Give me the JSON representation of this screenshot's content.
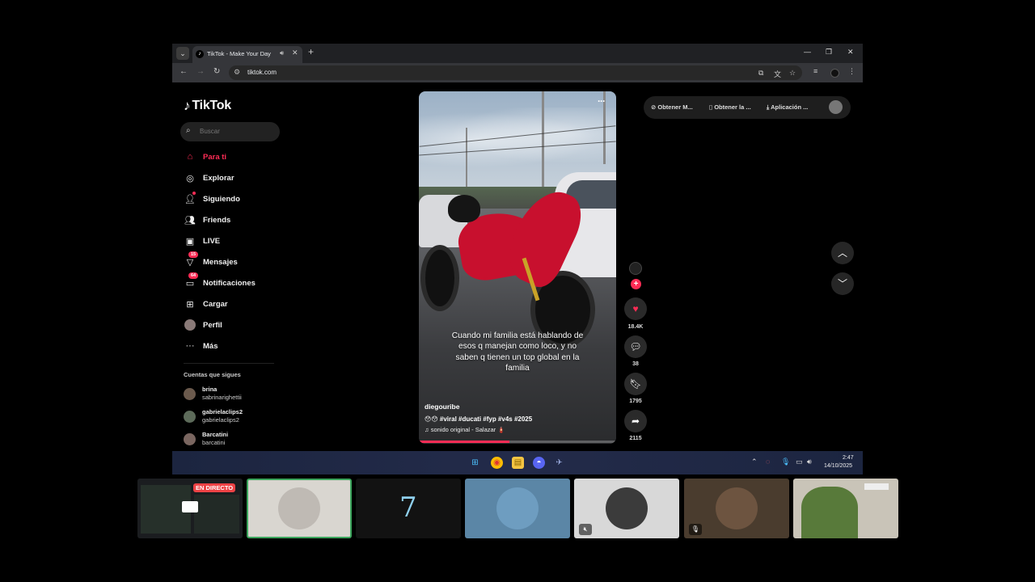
{
  "browser": {
    "tab_title": "TikTok - Make Your Day",
    "url": "tiktok.com"
  },
  "tiktok": {
    "logo": "TikTok",
    "search_placeholder": "Buscar",
    "nav": [
      {
        "label": "Para ti",
        "icon": "home-icon",
        "active": true
      },
      {
        "label": "Explorar",
        "icon": "compass-icon"
      },
      {
        "label": "Siguiendo",
        "icon": "following-icon"
      },
      {
        "label": "Friends",
        "icon": "friends-icon"
      },
      {
        "label": "LIVE",
        "icon": "live-icon"
      },
      {
        "label": "Mensajes",
        "icon": "messages-icon",
        "badge": "15"
      },
      {
        "label": "Notificaciones",
        "icon": "notifications-icon",
        "badge": "64"
      },
      {
        "label": "Cargar",
        "icon": "upload-icon"
      },
      {
        "label": "Perfil",
        "icon": "profile-icon"
      },
      {
        "label": "Más",
        "icon": "more-icon"
      }
    ],
    "following_title": "Cuentas que sigues",
    "following": [
      {
        "name": "brina",
        "handle": "sabrinarighettii"
      },
      {
        "name": "gabrielaclips2",
        "handle": "gabrielaclips2"
      },
      {
        "name": "Barcatini",
        "handle": "barcatini"
      }
    ],
    "top_actions": [
      "Obtener M...",
      "Obtener la ...",
      "Aplicación ..."
    ],
    "video": {
      "caption": "Cuando mi familia está hablando de esos q manejan como loco, y no saben q tienen un top global en la familia",
      "author": "diegouribe",
      "hashtags": "😯😯 #viral #ducati #fyp #v4s #2025",
      "sound": "sonido original - Salazar 🧯",
      "progress": 0.46
    },
    "actions": {
      "likes": "18.4K",
      "comments": "38",
      "saves": "1795",
      "shares": "2115"
    }
  },
  "taskbar": {
    "time": "2:47",
    "date": "14/10/2025"
  },
  "call": {
    "live_label": "EN DIRECTO"
  }
}
